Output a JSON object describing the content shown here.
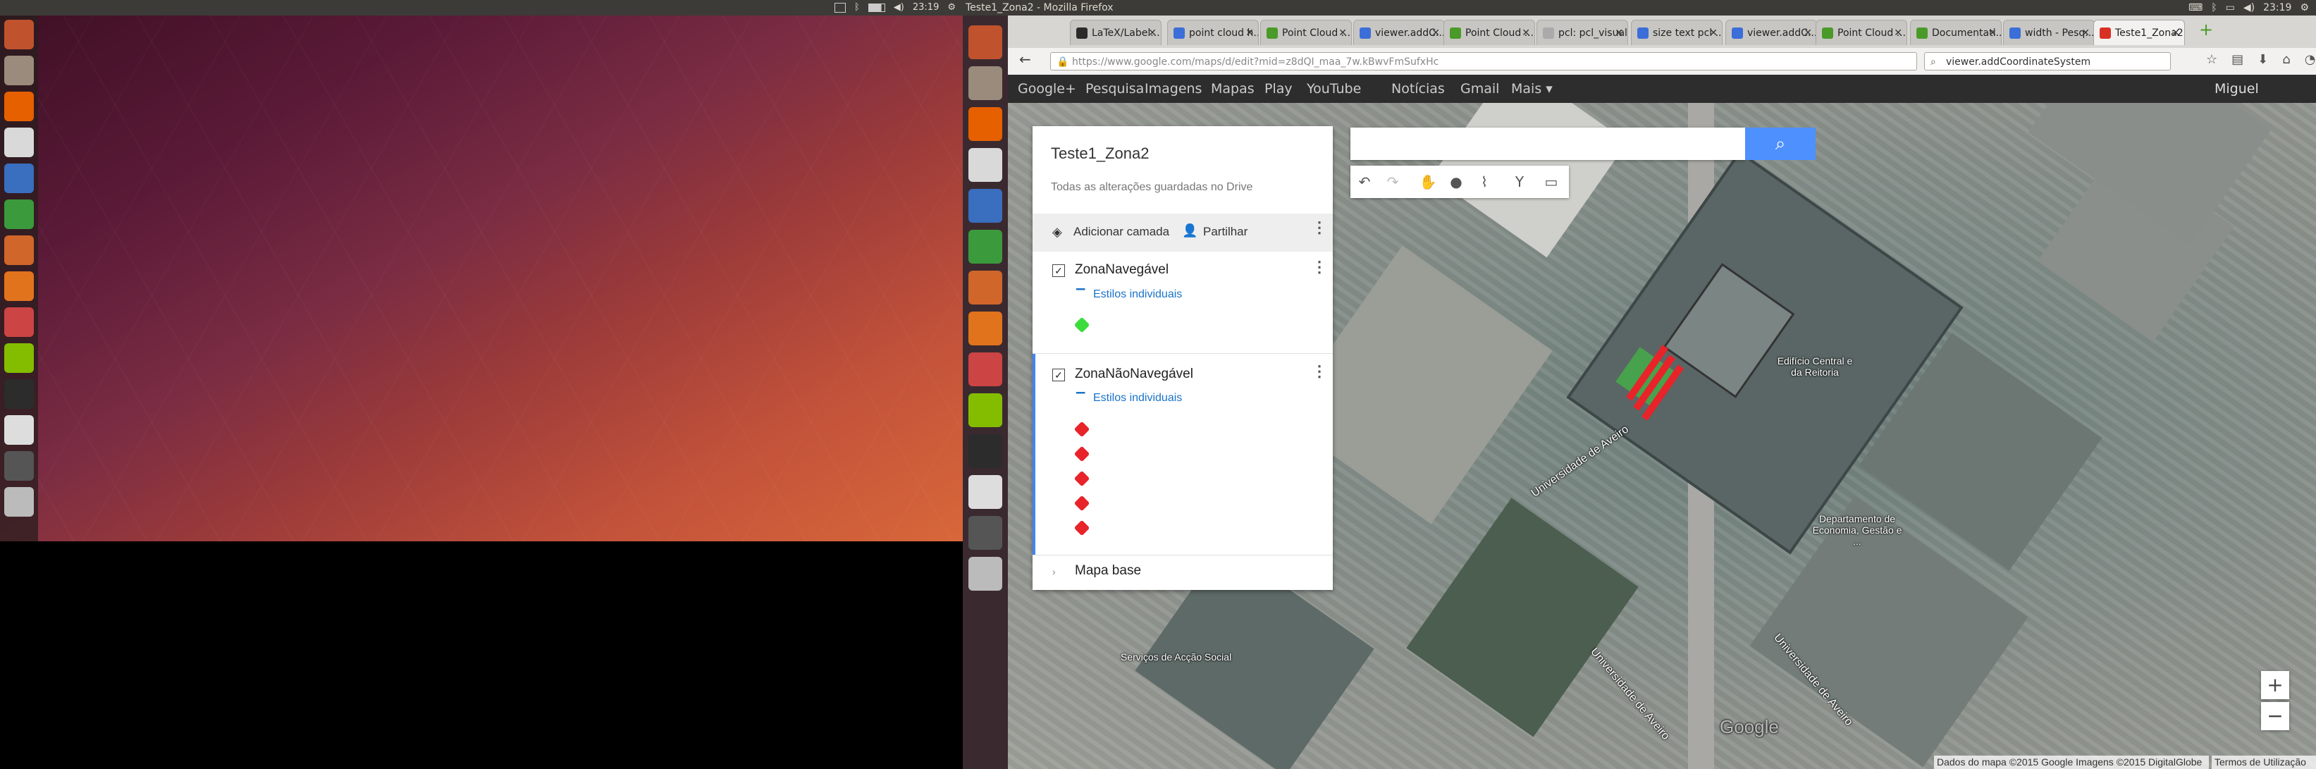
{
  "left_panel": {
    "clock": "23:19"
  },
  "launcher_left": [
    {
      "icon": "ubuntu-dash-icon",
      "color": "#c0532e"
    },
    {
      "icon": "files-icon",
      "color": "#9b8b7c"
    },
    {
      "icon": "firefox-icon",
      "color": "#e66000"
    },
    {
      "icon": "text-editor-icon",
      "color": "#d9d9d9"
    },
    {
      "icon": "writer-icon",
      "color": "#3a6ebf"
    },
    {
      "icon": "calc-icon",
      "color": "#3b9a3b"
    },
    {
      "icon": "impress-icon",
      "color": "#d0662a"
    },
    {
      "icon": "software-center-icon",
      "color": "#e2731d"
    },
    {
      "icon": "system-settings-icon",
      "color": "#c44"
    },
    {
      "icon": "spotify-icon",
      "color": "#84bd00"
    },
    {
      "icon": "terminal-icon",
      "color": "#2c2c2c"
    },
    {
      "icon": "tex-icon",
      "color": "#dddddd"
    },
    {
      "icon": "calculator-icon",
      "color": "#555"
    },
    {
      "icon": "drive-icon",
      "color": "#bbb"
    }
  ],
  "window": {
    "title": "Teste1_Zona2 - Mozilla Firefox",
    "clock": "23:19"
  },
  "tabs": [
    {
      "label": "LaTeX/Label...",
      "fav": "#2a2a2a"
    },
    {
      "label": "point cloud h...",
      "fav": "#3b6ed8"
    },
    {
      "label": "Point Cloud ...",
      "fav": "#4a9a2a"
    },
    {
      "label": "viewer.addC...",
      "fav": "#3b6ed8"
    },
    {
      "label": "Point Cloud ...",
      "fav": "#4a9a2a"
    },
    {
      "label": "pcl: pcl_visualize...",
      "fav": "#aaaaaa"
    },
    {
      "label": "size text pcl ...",
      "fav": "#3b6ed8"
    },
    {
      "label": "viewer.addC...",
      "fav": "#3b6ed8"
    },
    {
      "label": "Point Cloud ...",
      "fav": "#4a9a2a"
    },
    {
      "label": "Documentati...",
      "fav": "#4a9a2a"
    },
    {
      "label": "width - Pesq...",
      "fav": "#3b6ed8"
    },
    {
      "label": "Teste1_Zona2",
      "fav": "#d93025",
      "active": true
    }
  ],
  "nav": {
    "url": "https://www.google.com/maps/d/edit?mid=z8dQI_maa_7w.kBwvFmSufxHc",
    "search_value": "viewer.addCoordinateSystem"
  },
  "gbar": {
    "links": [
      "Google+",
      "Pesquisa",
      "Imagens",
      "Mapas",
      "Play",
      "YouTube",
      "Notícias",
      "Gmail",
      "Mais"
    ],
    "user": "Miguel Rodrigues"
  },
  "map_panel": {
    "title": "Teste1_Zona2",
    "subtitle": "Todas as alterações guardadas no Drive",
    "add_layer": "Adicionar camada",
    "share": "Partilhar",
    "layers": [
      {
        "name": "ZonaNavegável",
        "style": "Estilos individuais",
        "marker_color": "#3ddc3d",
        "markers": 1
      },
      {
        "name": "ZonaNãoNavegável",
        "style": "Estilos individuais",
        "marker_color": "#e8232a",
        "markers": 5
      }
    ],
    "base_map": "Mapa base"
  },
  "map_labels": {
    "edificio": "Edifício Central e da Reitoria",
    "departamento": "Departamento de Economia, Gestão e ...",
    "servicos": "Serviços de Acção Social",
    "univ1": "Universidade de Aveiro",
    "univ2": "Universidade de Aveiro",
    "univ3": "Universidade de Aveiro",
    "google": "Google"
  },
  "attribution": {
    "data": "Dados do mapa ©2015 Google Imagens ©2015 DigitalGlobe",
    "terms": "Termos de Utilização"
  }
}
